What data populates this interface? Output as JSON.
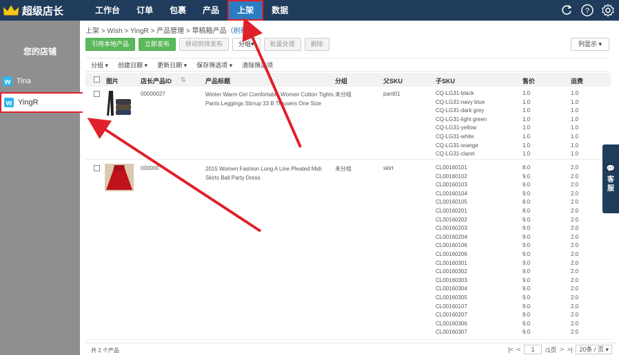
{
  "app": {
    "title": "超级店长"
  },
  "nav": {
    "items": [
      "工作台",
      "订单",
      "包裹",
      "产品",
      "上架",
      "数据"
    ],
    "active": "上架"
  },
  "top_icons": [
    "refresh-icon",
    "help-icon",
    "settings-icon"
  ],
  "sidebar": {
    "title": "您的店铺",
    "shops": [
      {
        "name": "Tina",
        "icon": "wish-icon"
      },
      {
        "name": "YingR",
        "icon": "wish-icon",
        "selected": true
      }
    ]
  },
  "breadcrumb": {
    "path": "上架 > Wish > YingR > 产品管理 > 草稿箱产品（",
    "refresh": "刷新",
    "end": "）"
  },
  "toolbar": {
    "import_local": "引用本地产品",
    "publish_now": "立即发布",
    "move_to_pending": "移动到待发布",
    "group": "分组▾",
    "batch": "批量处理",
    "delete": "删除",
    "columns": "列显示 ▾"
  },
  "filters": [
    "分组 ▾",
    "创建日期 ▾",
    "更新日期 ▾",
    "保存筛选项 ▾",
    "清除筛选项"
  ],
  "table": {
    "headers": {
      "image": "图片",
      "shop_id": "店长产品ID",
      "title": "产品标题",
      "group": "分组",
      "parent_sku": "父SKU",
      "child_sku": "子SKU",
      "price": "售价",
      "shipping": "运费"
    },
    "rows": [
      {
        "id": "00000027",
        "title": "Winter Warm Girl Comfortable Women Cotton Tights Pants Leggings Stirrup 33 B Trousers One Size",
        "group": "未分组",
        "parent_sku": "pant01",
        "skus": [
          "CQ-LG31-black",
          "CQ-LG31-navy blue",
          "CQ-LG31-dark grey",
          "CQ-LG31-light green",
          "CQ-LG31-yellow",
          "CQ-LG31-white",
          "CQ-LG31-orange",
          "CQ-LG31-claret"
        ],
        "prices": [
          "1.0",
          "1.0",
          "1.0",
          "1.0",
          "1.0",
          "1.0",
          "1.0",
          "1.0"
        ],
        "shipping": [
          "1.0",
          "1.0",
          "1.0",
          "1.0",
          "1.0",
          "1.0",
          "1.0",
          "1.0"
        ]
      },
      {
        "id": "000000",
        "title": "2015 Women Fashion Long A Line Pleated Midi Skirts Ball Party Dress",
        "group": "未分组",
        "parent_sku": "skirt",
        "skus": [
          "CL00160101",
          "CL00160102",
          "CL00160103",
          "CL00160104",
          "CL00160105",
          "CL00160201",
          "CL00160202",
          "CL00160203",
          "CL00160204",
          "CL00160106",
          "CL00160206",
          "CL00160301",
          "CL00160302",
          "CL00160303",
          "CL00160304",
          "CL00160305",
          "CL00160107",
          "CL00160207",
          "CL00160306",
          "CL00160307"
        ],
        "prices": [
          "8.0",
          "9.0",
          "9.0",
          "9.0",
          "8.0",
          "8.0",
          "9.0",
          "9.0",
          "9.0",
          "9.0",
          "9.0",
          "9.0",
          "9.0",
          "9.0",
          "9.0",
          "9.0",
          "9.0",
          "9.0",
          "9.0",
          "9.0"
        ],
        "shipping": [
          "2.0",
          "2.0",
          "2.0",
          "2.0",
          "2.0",
          "2.0",
          "2.0",
          "2.0",
          "2.0",
          "2.0",
          "2.0",
          "2.0",
          "2.0",
          "2.0",
          "2.0",
          "2.0",
          "2.0",
          "2.0",
          "2.0",
          "2.0"
        ]
      }
    ]
  },
  "footer": {
    "total": "共 2 个产品",
    "page": "1",
    "page_total": "/1页",
    "page_size": "20条 / 页 ▾"
  },
  "service": {
    "label": "客服"
  },
  "colors": {
    "topbar": "#1f3c5c",
    "active_tab": "#2c7cc1",
    "highlight": "#e0202a",
    "sidebar": "#8f8f8f",
    "green": "#5cb85c"
  }
}
